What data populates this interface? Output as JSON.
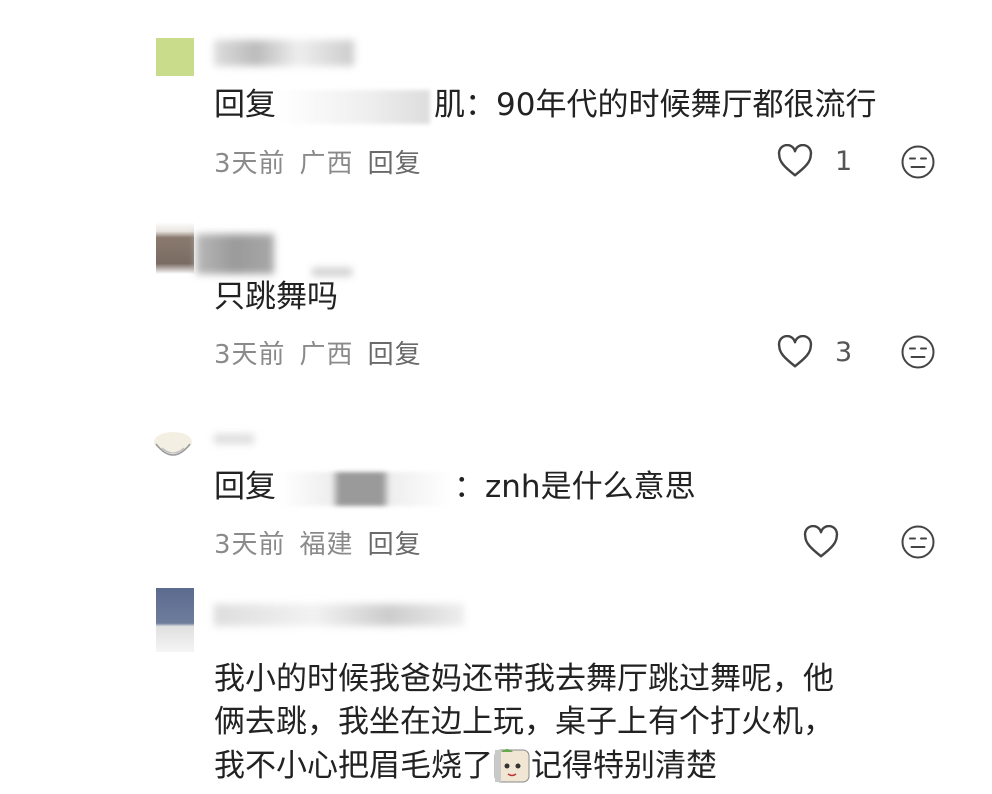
{
  "comments": [
    {
      "username": "",
      "reply_prefix": "回复",
      "reply_to_suffix": "肌：",
      "text": "90年代的时候舞厅都很流行",
      "time": "3天前",
      "location": "广西",
      "reply_label": "回复",
      "likes": "1"
    },
    {
      "username": "",
      "text": "只跳舞吗",
      "time": "3天前",
      "location": "广西",
      "reply_label": "回复",
      "likes": "3"
    },
    {
      "username": "",
      "reply_prefix": "回复",
      "reply_to_suffix": "：",
      "text": "znh是什么意思",
      "time": "3天前",
      "location": "福建",
      "reply_label": "回复",
      "likes": ""
    },
    {
      "username": "",
      "lines": [
        "我小的时候我爸妈还带我去舞厅跳过舞呢，他",
        "俩去跳，我坐在边上玩，桌子上有个打火机，",
        "我不小心把眉毛烧了",
        "记得特别清楚"
      ]
    }
  ],
  "icons": {
    "like": "heart-outline-icon",
    "reaction": "neutral-face-icon",
    "sticker": "sticker-emoji-icon"
  },
  "colors": {
    "text": "#222222",
    "meta": "#8a8a8a",
    "icon": "#444444"
  }
}
